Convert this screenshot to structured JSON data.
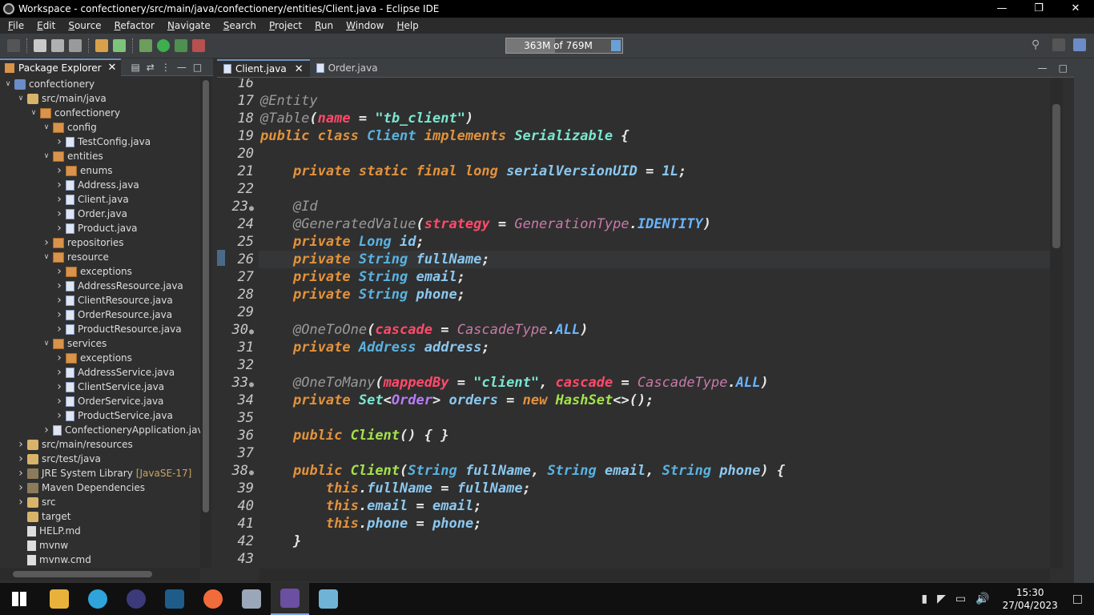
{
  "window": {
    "title": "Workspace - confectionery/src/main/java/confectionery/entities/Client.java - Eclipse IDE"
  },
  "menu": [
    "File",
    "Edit",
    "Source",
    "Refactor",
    "Navigate",
    "Search",
    "Project",
    "Run",
    "Window",
    "Help"
  ],
  "heap": {
    "used": "363M",
    "total": "769M",
    "label": "363M of 769M",
    "fraction": 0.47
  },
  "package_explorer": {
    "tab_label": "Package Explorer",
    "tree": [
      {
        "label": "confectionery",
        "depth": 0,
        "icon": "project-icon",
        "open": true
      },
      {
        "label": "src/main/java",
        "depth": 1,
        "icon": "source-folder-icon",
        "open": true
      },
      {
        "label": "confectionery",
        "depth": 2,
        "icon": "package-icon",
        "open": true
      },
      {
        "label": "config",
        "depth": 3,
        "icon": "package-icon",
        "open": true
      },
      {
        "label": "TestConfig.java",
        "depth": 4,
        "icon": "java-file-icon",
        "open": false
      },
      {
        "label": "entities",
        "depth": 3,
        "icon": "package-icon",
        "open": true
      },
      {
        "label": "enums",
        "depth": 4,
        "icon": "package-icon",
        "open": false
      },
      {
        "label": "Address.java",
        "depth": 4,
        "icon": "java-file-icon",
        "open": false
      },
      {
        "label": "Client.java",
        "depth": 4,
        "icon": "java-file-icon",
        "open": false
      },
      {
        "label": "Order.java",
        "depth": 4,
        "icon": "java-file-icon",
        "open": false
      },
      {
        "label": "Product.java",
        "depth": 4,
        "icon": "java-file-icon",
        "open": false
      },
      {
        "label": "repositories",
        "depth": 3,
        "icon": "package-icon",
        "open": false
      },
      {
        "label": "resource",
        "depth": 3,
        "icon": "package-icon",
        "open": true
      },
      {
        "label": "exceptions",
        "depth": 4,
        "icon": "package-icon",
        "open": false
      },
      {
        "label": "AddressResource.java",
        "depth": 4,
        "icon": "java-file-icon",
        "open": false
      },
      {
        "label": "ClientResource.java",
        "depth": 4,
        "icon": "java-file-icon",
        "open": false
      },
      {
        "label": "OrderResource.java",
        "depth": 4,
        "icon": "java-file-icon",
        "open": false
      },
      {
        "label": "ProductResource.java",
        "depth": 4,
        "icon": "java-file-icon",
        "open": false
      },
      {
        "label": "services",
        "depth": 3,
        "icon": "package-icon",
        "open": true
      },
      {
        "label": "exceptions",
        "depth": 4,
        "icon": "package-icon",
        "open": false
      },
      {
        "label": "AddressService.java",
        "depth": 4,
        "icon": "java-file-icon",
        "open": false
      },
      {
        "label": "ClientService.java",
        "depth": 4,
        "icon": "java-file-icon",
        "open": false
      },
      {
        "label": "OrderService.java",
        "depth": 4,
        "icon": "java-file-icon",
        "open": false
      },
      {
        "label": "ProductService.java",
        "depth": 4,
        "icon": "java-file-icon",
        "open": false
      },
      {
        "label": "ConfectioneryApplication.java",
        "depth": 3,
        "icon": "java-file-icon",
        "open": false
      },
      {
        "label": "src/main/resources",
        "depth": 1,
        "icon": "source-folder-icon",
        "open": false
      },
      {
        "label": "src/test/java",
        "depth": 1,
        "icon": "source-folder-icon",
        "open": false
      },
      {
        "label": "JRE System Library",
        "extra": "[JavaSE-17]",
        "depth": 1,
        "icon": "library-icon",
        "open": false
      },
      {
        "label": "Maven Dependencies",
        "depth": 1,
        "icon": "library-icon",
        "open": false
      },
      {
        "label": "src",
        "depth": 1,
        "icon": "folder-icon",
        "open": false
      },
      {
        "label": "target",
        "depth": 1,
        "icon": "folder-icon",
        "open": null
      },
      {
        "label": "HELP.md",
        "depth": 1,
        "icon": "markdown-file-icon",
        "open": null
      },
      {
        "label": "mvnw",
        "depth": 1,
        "icon": "file-icon",
        "open": null
      },
      {
        "label": "mvnw.cmd",
        "depth": 1,
        "icon": "file-icon",
        "open": null
      }
    ]
  },
  "editor": {
    "tabs": [
      {
        "label": "Client.java",
        "active": true
      },
      {
        "label": "Order.java",
        "active": false
      }
    ],
    "current_line": 26,
    "lines": [
      {
        "n": "16",
        "fold": false,
        "tokens": []
      },
      {
        "n": "17",
        "fold": false,
        "tokens": [
          [
            "ann",
            "@Entity"
          ]
        ]
      },
      {
        "n": "18",
        "fold": false,
        "tokens": [
          [
            "ann",
            "@Table"
          ],
          [
            "plain",
            "("
          ],
          [
            "prm",
            "name"
          ],
          [
            "plain",
            " = "
          ],
          [
            "str",
            "\"tb_client\""
          ],
          [
            "plain",
            ")"
          ]
        ]
      },
      {
        "n": "19",
        "fold": false,
        "tokens": [
          [
            "kw",
            "public class "
          ],
          [
            "ty",
            "Client "
          ],
          [
            "kw",
            "implements "
          ],
          [
            "str",
            "Serializable"
          ],
          [
            "plain",
            " {"
          ]
        ]
      },
      {
        "n": "20",
        "fold": false,
        "tokens": []
      },
      {
        "n": "21",
        "fold": false,
        "tokens": [
          [
            "plain",
            "    "
          ],
          [
            "kw",
            "private static final long "
          ],
          [
            "fld",
            "serialVersionUID"
          ],
          [
            "plain",
            " = "
          ],
          [
            "num",
            "1L"
          ],
          [
            "plain",
            ";"
          ]
        ]
      },
      {
        "n": "22",
        "fold": false,
        "tokens": []
      },
      {
        "n": "23",
        "fold": true,
        "tokens": [
          [
            "plain",
            "    "
          ],
          [
            "ann",
            "@Id"
          ]
        ]
      },
      {
        "n": "24",
        "fold": false,
        "tokens": [
          [
            "plain",
            "    "
          ],
          [
            "ann",
            "@GeneratedValue"
          ],
          [
            "plain",
            "("
          ],
          [
            "prm",
            "strategy"
          ],
          [
            "plain",
            " = "
          ],
          [
            "enum",
            "GenerationType"
          ],
          [
            "plain",
            "."
          ],
          [
            "const",
            "IDENTITY"
          ],
          [
            "plain",
            ")"
          ]
        ]
      },
      {
        "n": "25",
        "fold": false,
        "tokens": [
          [
            "plain",
            "    "
          ],
          [
            "kw",
            "private "
          ],
          [
            "ty",
            "Long "
          ],
          [
            "fld",
            "id"
          ],
          [
            "plain",
            ";"
          ]
        ]
      },
      {
        "n": "26",
        "fold": false,
        "tokens": [
          [
            "plain",
            "    "
          ],
          [
            "kw",
            "private "
          ],
          [
            "ty",
            "String "
          ],
          [
            "fld",
            "fullName"
          ],
          [
            "plain",
            ";"
          ]
        ]
      },
      {
        "n": "27",
        "fold": false,
        "tokens": [
          [
            "plain",
            "    "
          ],
          [
            "kw",
            "private "
          ],
          [
            "ty",
            "String "
          ],
          [
            "fld",
            "email"
          ],
          [
            "plain",
            ";"
          ]
        ]
      },
      {
        "n": "28",
        "fold": false,
        "tokens": [
          [
            "plain",
            "    "
          ],
          [
            "kw",
            "private "
          ],
          [
            "ty",
            "String "
          ],
          [
            "fld",
            "phone"
          ],
          [
            "plain",
            ";"
          ]
        ]
      },
      {
        "n": "29",
        "fold": false,
        "tokens": []
      },
      {
        "n": "30",
        "fold": true,
        "tokens": [
          [
            "plain",
            "    "
          ],
          [
            "ann",
            "@OneToOne"
          ],
          [
            "plain",
            "("
          ],
          [
            "prm",
            "cascade"
          ],
          [
            "plain",
            " = "
          ],
          [
            "enum",
            "CascadeType"
          ],
          [
            "plain",
            "."
          ],
          [
            "const",
            "ALL"
          ],
          [
            "plain",
            ")"
          ]
        ]
      },
      {
        "n": "31",
        "fold": false,
        "tokens": [
          [
            "plain",
            "    "
          ],
          [
            "kw",
            "private "
          ],
          [
            "ty",
            "Address "
          ],
          [
            "fld",
            "address"
          ],
          [
            "plain",
            ";"
          ]
        ]
      },
      {
        "n": "32",
        "fold": false,
        "tokens": []
      },
      {
        "n": "33",
        "fold": true,
        "tokens": [
          [
            "plain",
            "    "
          ],
          [
            "ann",
            "@OneToMany"
          ],
          [
            "plain",
            "("
          ],
          [
            "prm",
            "mappedBy"
          ],
          [
            "plain",
            " = "
          ],
          [
            "str",
            "\"client\""
          ],
          [
            "plain",
            ", "
          ],
          [
            "prm",
            "cascade"
          ],
          [
            "plain",
            " = "
          ],
          [
            "enum",
            "CascadeType"
          ],
          [
            "plain",
            "."
          ],
          [
            "const",
            "ALL"
          ],
          [
            "plain",
            ")"
          ]
        ]
      },
      {
        "n": "34",
        "fold": false,
        "tokens": [
          [
            "plain",
            "    "
          ],
          [
            "kw",
            "private "
          ],
          [
            "str",
            "Set"
          ],
          [
            "plain",
            "<"
          ],
          [
            "gen",
            "Order"
          ],
          [
            "plain",
            "> "
          ],
          [
            "fld",
            "orders"
          ],
          [
            "plain",
            " = "
          ],
          [
            "kw",
            "new "
          ],
          [
            "ctor",
            "HashSet"
          ],
          [
            "plain",
            "<>();"
          ]
        ]
      },
      {
        "n": "35",
        "fold": false,
        "tokens": []
      },
      {
        "n": "36",
        "fold": false,
        "tokens": [
          [
            "plain",
            "    "
          ],
          [
            "kw",
            "public "
          ],
          [
            "ctor",
            "Client"
          ],
          [
            "plain",
            "() { }"
          ]
        ]
      },
      {
        "n": "37",
        "fold": false,
        "tokens": []
      },
      {
        "n": "38",
        "fold": true,
        "tokens": [
          [
            "plain",
            "    "
          ],
          [
            "kw",
            "public "
          ],
          [
            "ctor",
            "Client"
          ],
          [
            "plain",
            "("
          ],
          [
            "ty",
            "String "
          ],
          [
            "fld",
            "fullName"
          ],
          [
            "plain",
            ", "
          ],
          [
            "ty",
            "String "
          ],
          [
            "fld",
            "email"
          ],
          [
            "plain",
            ", "
          ],
          [
            "ty",
            "String "
          ],
          [
            "fld",
            "phone"
          ],
          [
            "plain",
            ") {"
          ]
        ]
      },
      {
        "n": "39",
        "fold": false,
        "tokens": [
          [
            "plain",
            "        "
          ],
          [
            "kw",
            "this"
          ],
          [
            "plain",
            "."
          ],
          [
            "fld",
            "fullName"
          ],
          [
            "plain",
            " = "
          ],
          [
            "fld",
            "fullName"
          ],
          [
            "plain",
            ";"
          ]
        ]
      },
      {
        "n": "40",
        "fold": false,
        "tokens": [
          [
            "plain",
            "        "
          ],
          [
            "kw",
            "this"
          ],
          [
            "plain",
            "."
          ],
          [
            "fld",
            "email"
          ],
          [
            "plain",
            " = "
          ],
          [
            "fld",
            "email"
          ],
          [
            "plain",
            ";"
          ]
        ]
      },
      {
        "n": "41",
        "fold": false,
        "tokens": [
          [
            "plain",
            "        "
          ],
          [
            "kw",
            "this"
          ],
          [
            "plain",
            "."
          ],
          [
            "fld",
            "phone"
          ],
          [
            "plain",
            " = "
          ],
          [
            "fld",
            "phone"
          ],
          [
            "plain",
            ";"
          ]
        ]
      },
      {
        "n": "42",
        "fold": false,
        "tokens": [
          [
            "plain",
            "    }"
          ]
        ]
      },
      {
        "n": "43",
        "fold": false,
        "tokens": []
      }
    ]
  },
  "taskbar": {
    "apps": [
      {
        "name": "file-explorer-icon",
        "color": "#e8b23a"
      },
      {
        "name": "edge-icon",
        "color": "#2fa3dc"
      },
      {
        "name": "eclipse-icon",
        "color": "#3c3a7a"
      },
      {
        "name": "mysql-workbench-icon",
        "color": "#1e5c8a"
      },
      {
        "name": "postman-icon",
        "color": "#f26b3a"
      },
      {
        "name": "app-window-icon",
        "color": "#9aa7b8"
      },
      {
        "name": "eclipse-ide-icon",
        "color": "#6b4fa0",
        "active": true
      },
      {
        "name": "notes-icon",
        "color": "#6fb3d6"
      }
    ],
    "time": "15:30",
    "date": "27/04/2023"
  }
}
